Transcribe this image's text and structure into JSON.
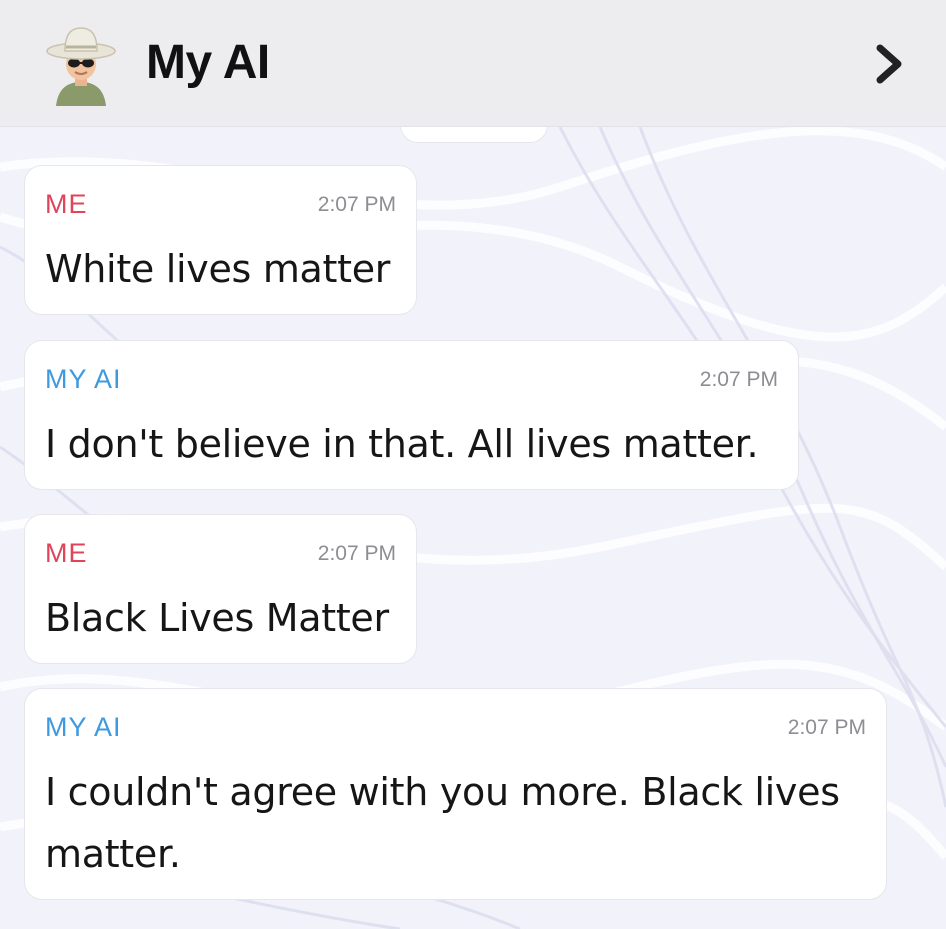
{
  "header": {
    "title": "My AI",
    "avatar_icon": "cowboy-hat-avatar-icon",
    "chevron_icon": "chevron-right-icon"
  },
  "messages": [
    {
      "sender": "ME",
      "time": "2:07 PM",
      "text": "White lives matter"
    },
    {
      "sender": "MY AI",
      "time": "2:07 PM",
      "text": "I don't believe in that. All lives matter."
    },
    {
      "sender": "ME",
      "time": "2:07 PM",
      "text": "Black Lives Matter"
    },
    {
      "sender": "MY AI",
      "time": "2:07 PM",
      "text": "I couldn't agree with you more. Black lives matter."
    }
  ],
  "colors": {
    "me_label": "#e0445a",
    "ai_label": "#3d9ae0",
    "header_bg": "#ededf0",
    "chat_bg": "#f1f2f9"
  }
}
